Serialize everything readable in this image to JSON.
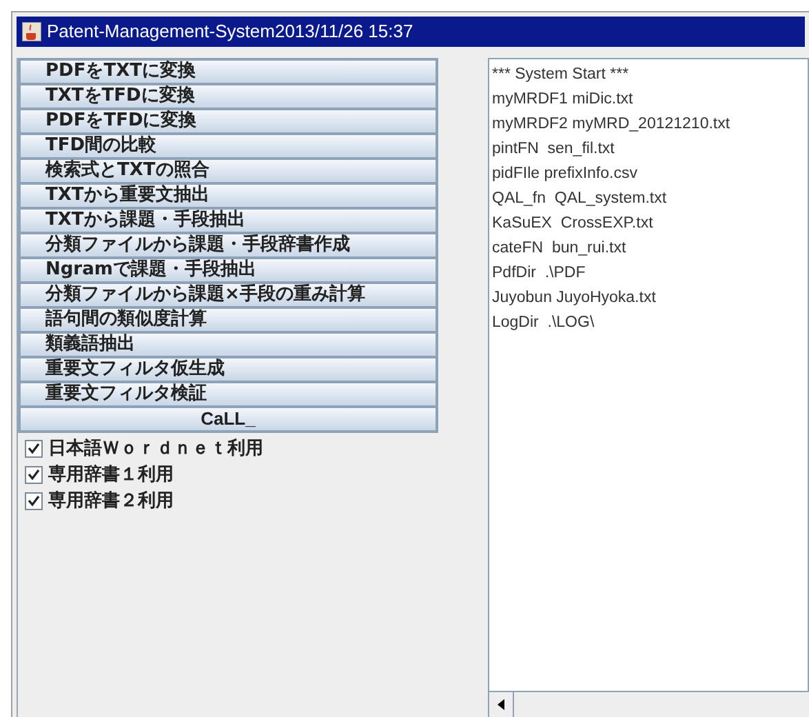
{
  "window": {
    "title": "Patent-Management-System2013/11/26 15:37"
  },
  "buttons": [
    {
      "label": "PDFをTXTに変換"
    },
    {
      "label": "TXTをTFDに変換"
    },
    {
      "label": "PDFをTFDに変換"
    },
    {
      "label": "TFD間の比較"
    },
    {
      "label": "検索式とTXTの照合"
    },
    {
      "label": "TXTから重要文抽出"
    },
    {
      "label": "TXTから課題・手段抽出"
    },
    {
      "label": "分類ファイルから課題・手段辞書作成"
    },
    {
      "label": "Ngramで課題・手段抽出"
    },
    {
      "label": "分類ファイルから課題×手段の重み計算"
    },
    {
      "label": "語句間の類似度計算"
    },
    {
      "label": "類義語抽出"
    },
    {
      "label": "重要文フィルタ仮生成"
    },
    {
      "label": "重要文フィルタ検証"
    }
  ],
  "call_button": {
    "label": "CaLL_"
  },
  "checkboxes": [
    {
      "label": "日本語Ｗｏｒｄｎｅｔ利用",
      "checked": true
    },
    {
      "label": "専用辞書１利用",
      "checked": true
    },
    {
      "label": "専用辞書２利用",
      "checked": true
    }
  ],
  "log": [
    "*** System Start ***",
    "myMRDF1 miDic.txt",
    "myMRDF2 myMRD_20121210.txt",
    "pintFN  sen_fil.txt",
    "pidFIle prefixInfo.csv",
    "QAL_fn  QAL_system.txt",
    "KaSuEX  CrossEXP.txt",
    "cateFN  bun_rui.txt",
    "PdfDir  .\\PDF",
    "Juyobun JuyoHyoka.txt",
    "LogDir  .\\LOG\\"
  ]
}
